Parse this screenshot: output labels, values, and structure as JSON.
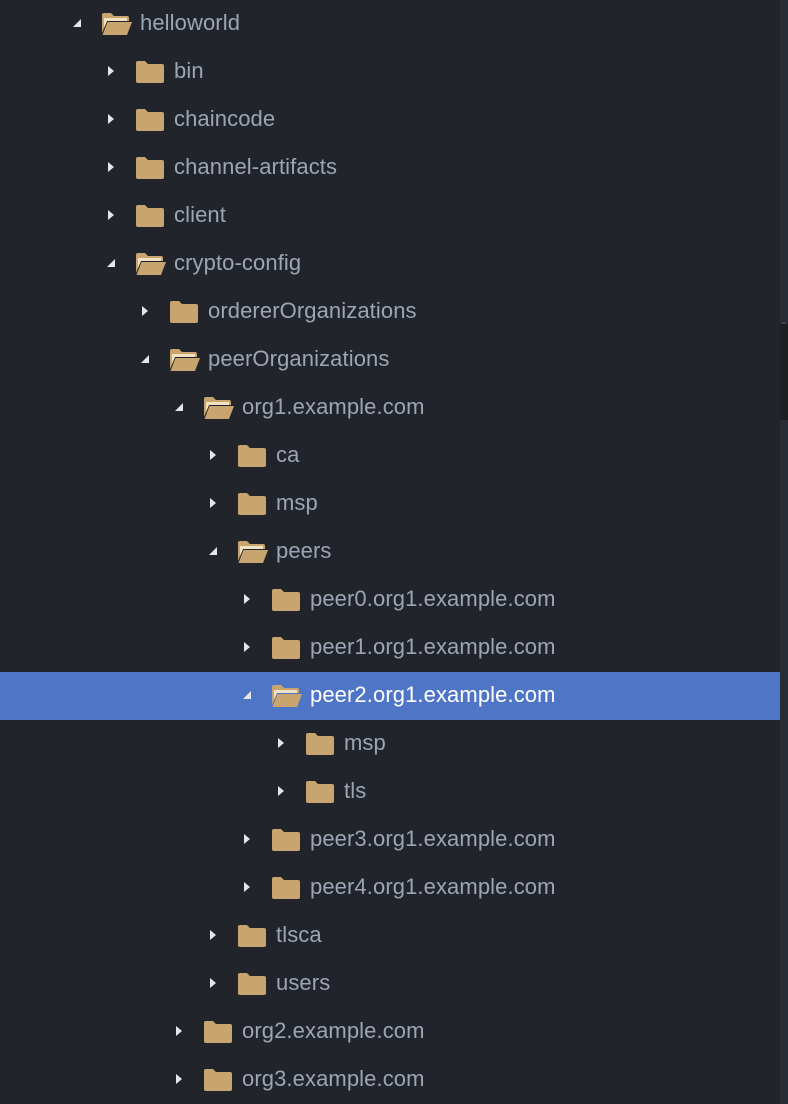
{
  "tree_view": {
    "items": [
      {
        "label": "helloworld",
        "depth": 0,
        "expanded": true,
        "selected": false,
        "icon": "folder-open-icon"
      },
      {
        "label": "bin",
        "depth": 1,
        "expanded": false,
        "selected": false,
        "icon": "folder-icon"
      },
      {
        "label": "chaincode",
        "depth": 1,
        "expanded": false,
        "selected": false,
        "icon": "folder-icon"
      },
      {
        "label": "channel-artifacts",
        "depth": 1,
        "expanded": false,
        "selected": false,
        "icon": "folder-icon"
      },
      {
        "label": "client",
        "depth": 1,
        "expanded": false,
        "selected": false,
        "icon": "folder-icon"
      },
      {
        "label": "crypto-config",
        "depth": 1,
        "expanded": true,
        "selected": false,
        "icon": "folder-open-icon"
      },
      {
        "label": "ordererOrganizations",
        "depth": 2,
        "expanded": false,
        "selected": false,
        "icon": "folder-icon"
      },
      {
        "label": "peerOrganizations",
        "depth": 2,
        "expanded": true,
        "selected": false,
        "icon": "folder-open-icon"
      },
      {
        "label": "org1.example.com",
        "depth": 3,
        "expanded": true,
        "selected": false,
        "icon": "folder-open-icon"
      },
      {
        "label": "ca",
        "depth": 4,
        "expanded": false,
        "selected": false,
        "icon": "folder-icon"
      },
      {
        "label": "msp",
        "depth": 4,
        "expanded": false,
        "selected": false,
        "icon": "folder-icon"
      },
      {
        "label": "peers",
        "depth": 4,
        "expanded": true,
        "selected": false,
        "icon": "folder-open-icon"
      },
      {
        "label": "peer0.org1.example.com",
        "depth": 5,
        "expanded": false,
        "selected": false,
        "icon": "folder-icon"
      },
      {
        "label": "peer1.org1.example.com",
        "depth": 5,
        "expanded": false,
        "selected": false,
        "icon": "folder-icon"
      },
      {
        "label": "peer2.org1.example.com",
        "depth": 5,
        "expanded": true,
        "selected": true,
        "icon": "folder-open-icon"
      },
      {
        "label": "msp",
        "depth": 6,
        "expanded": false,
        "selected": false,
        "icon": "folder-icon"
      },
      {
        "label": "tls",
        "depth": 6,
        "expanded": false,
        "selected": false,
        "icon": "folder-icon"
      },
      {
        "label": "peer3.org1.example.com",
        "depth": 5,
        "expanded": false,
        "selected": false,
        "icon": "folder-icon"
      },
      {
        "label": "peer4.org1.example.com",
        "depth": 5,
        "expanded": false,
        "selected": false,
        "icon": "folder-icon"
      },
      {
        "label": "tlsca",
        "depth": 4,
        "expanded": false,
        "selected": false,
        "icon": "folder-icon"
      },
      {
        "label": "users",
        "depth": 4,
        "expanded": false,
        "selected": false,
        "icon": "folder-icon"
      },
      {
        "label": "org2.example.com",
        "depth": 3,
        "expanded": false,
        "selected": false,
        "icon": "folder-icon"
      },
      {
        "label": "org3.example.com",
        "depth": 3,
        "expanded": false,
        "selected": false,
        "icon": "folder-icon"
      }
    ]
  },
  "colors": {
    "background": "#21252b",
    "text": "#9da5b4",
    "selected_background": "#4f76c6",
    "selected_text": "#ffffff",
    "folder": "#c8a46e",
    "arrow": "#e6e6e6"
  }
}
